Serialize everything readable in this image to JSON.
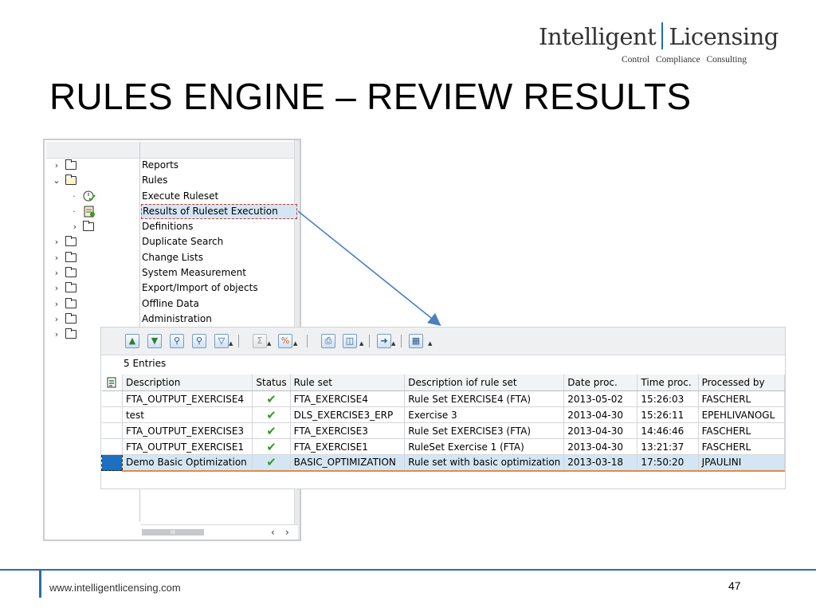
{
  "header": {
    "logo_main_left": "Intelligent",
    "logo_main_right": "Licensing",
    "logo_tagline": "Control Compliance Consulting",
    "title": "RULES ENGINE – REVIEW RESULTS"
  },
  "tree": {
    "items": [
      {
        "label": "Reports",
        "expander": "›",
        "icon": "folder-icon",
        "level": 0
      },
      {
        "label": "Rules",
        "expander": "⌄",
        "icon": "folder-open-icon",
        "level": 0
      },
      {
        "label": "Execute Ruleset",
        "expander": "·",
        "icon": "execute-clock-check-icon",
        "level": 1
      },
      {
        "label": "Results of Ruleset Execution",
        "expander": "·",
        "icon": "results-report-icon",
        "level": 1,
        "selected": true
      },
      {
        "label": "Definitions",
        "expander": "›",
        "icon": "folder-icon",
        "level": 1
      },
      {
        "label": "Duplicate Search",
        "expander": "›",
        "icon": "folder-icon",
        "level": 0
      },
      {
        "label": "Change Lists",
        "expander": "›",
        "icon": "folder-icon",
        "level": 0
      },
      {
        "label": "System Measurement",
        "expander": "›",
        "icon": "folder-icon",
        "level": 0
      },
      {
        "label": "Export/Import of objects",
        "expander": "›",
        "icon": "folder-icon",
        "level": 0
      },
      {
        "label": "Offline Data",
        "expander": "›",
        "icon": "folder-icon",
        "level": 0
      },
      {
        "label": "Administration",
        "expander": "›",
        "icon": "folder-icon",
        "level": 0
      },
      {
        "label": "",
        "expander": "›",
        "icon": "folder-icon",
        "level": 0
      }
    ],
    "scroll_thumb": "III",
    "scroll_left": "‹",
    "scroll_right": "›"
  },
  "grid": {
    "entries_label": "5  Entries",
    "toolbar_icons": [
      "sort-ascending-icon",
      "sort-descending-icon",
      "find-icon",
      "find-next-icon",
      "filter-icon",
      "sum-icon",
      "subtotals-icon",
      "print-icon",
      "views-icon",
      "export-icon",
      "layout-icon"
    ],
    "columns": [
      "Description",
      "Status",
      "Rule set",
      "Description iof rule set",
      "Date proc.",
      "Time proc.",
      "Processed by"
    ],
    "rows": [
      {
        "description": "FTA_OUTPUT_EXERCISE4",
        "status": "✔",
        "rule_set": "FTA_EXERCISE4",
        "rule_set_desc": "Rule Set EXERCISE4 (FTA)",
        "date": "2013-05-02",
        "time": "15:26:03",
        "user": "FASCHERL"
      },
      {
        "description": "test",
        "status": "✔",
        "rule_set": "DLS_EXERCISE3_ERP",
        "rule_set_desc": "Exercise 3",
        "date": "2013-04-30",
        "time": "15:26:11",
        "user": "EPEHLIVANOGL"
      },
      {
        "description": "FTA_OUTPUT_EXERCISE3",
        "status": "✔",
        "rule_set": "FTA_EXERCISE3",
        "rule_set_desc": "Rule Set EXERCISE3 (FTA)",
        "date": "2013-04-30",
        "time": "14:46:46",
        "user": "FASCHERL"
      },
      {
        "description": "FTA_OUTPUT_EXERCISE1",
        "status": "✔",
        "rule_set": "FTA_EXERCISE1",
        "rule_set_desc": "RuleSet Exercise 1 (FTA)",
        "date": "2013-04-30",
        "time": "13:21:37",
        "user": "FASCHERL"
      },
      {
        "description": "Demo Basic Optimization",
        "status": "✔",
        "rule_set": "BASIC_OPTIMIZATION",
        "rule_set_desc": "Rule set with basic optimization",
        "date": "2013-03-18",
        "time": "17:50:20",
        "user": "JPAULINI",
        "selected": true
      }
    ]
  },
  "footer": {
    "url": "www.intelligentlicensing.com",
    "page_number": "47"
  },
  "colors": {
    "accent_blue": "#2a6ea8",
    "selection_blue": "#d4e6f4",
    "status_green": "#3a9a2a"
  }
}
